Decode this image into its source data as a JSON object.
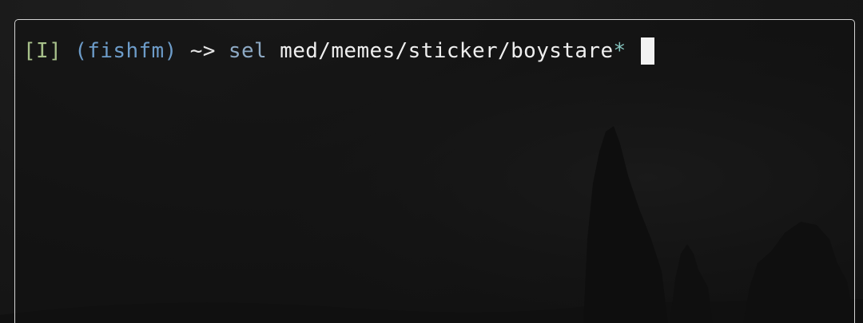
{
  "terminal": {
    "mode_indicator": "[I]",
    "virtualenv": "(fishfm)",
    "prompt_arrow": "~>",
    "command": "sel",
    "argument_path": "med/memes/sticker/boystare",
    "glob": "*"
  },
  "colors": {
    "mode": "#a7c08a",
    "virtualenv": "#6d9cc9",
    "command": "#8da9c4",
    "glob": "#86c6c0",
    "border": "#d4d4d4",
    "background": "#161616"
  },
  "icons": {
    "cursor": "block-cursor"
  }
}
